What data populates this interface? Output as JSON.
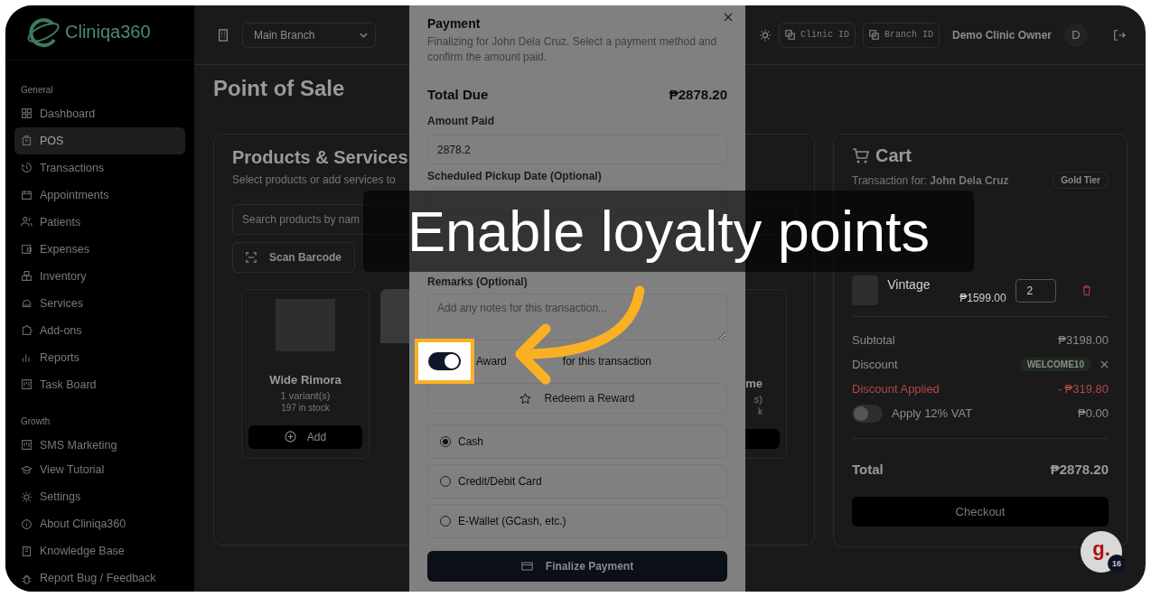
{
  "sidebar": {
    "logo": "Cliniqa360",
    "sections": [
      {
        "heading": "General",
        "items": [
          {
            "label": "Dashboard",
            "selected": false
          },
          {
            "label": "POS",
            "selected": true
          },
          {
            "label": "Transactions",
            "selected": false
          },
          {
            "label": "Appointments",
            "selected": false
          },
          {
            "label": "Patients",
            "selected": false
          },
          {
            "label": "Expenses",
            "selected": false
          },
          {
            "label": "Inventory",
            "selected": false
          },
          {
            "label": "Services",
            "selected": false
          },
          {
            "label": "Add-ons",
            "selected": false
          },
          {
            "label": "Reports",
            "selected": false
          },
          {
            "label": "Task Board",
            "selected": false
          }
        ]
      },
      {
        "heading": "Growth",
        "items": [
          {
            "label": "SMS Marketing",
            "selected": false
          }
        ]
      }
    ],
    "footer_items": [
      "View Tutorial",
      "Settings",
      "About Cliniqa360",
      "Knowledge Base",
      "Report Bug / Feedback"
    ]
  },
  "header": {
    "branch": "Main Branch",
    "clinic_id": "Clinic ID",
    "branch_id": "Branch ID",
    "user": "Demo Clinic Owner",
    "avatar": "D"
  },
  "page_title": "Point of Sale",
  "products": {
    "title": "Products & Services",
    "subtitle": "Select products or add services to",
    "search_placeholder": "Search products by nam",
    "scan_button": "Scan Barcode",
    "items": [
      {
        "kind": "full",
        "name": "Wide Rimora",
        "variants": "1 variant(s)",
        "stock": "197 in stock",
        "button": "Add"
      },
      {
        "kind": "photo"
      },
      {
        "kind": "hidden"
      },
      {
        "kind": "edge",
        "name": "me",
        "variants": "s)",
        "stock": "k"
      }
    ]
  },
  "cart": {
    "title": "Cart",
    "transaction_for": "Transaction for: **John Dela Cruz**",
    "tier": "Gold Tier",
    "item": {
      "name": "Vintage",
      "price": "₱1599.00",
      "quantity": "2"
    },
    "subtotal_label": "Subtotal",
    "subtotal": "₱3198.00",
    "discount_label": "Discount",
    "discount_code": "WELCOME10",
    "discount_applied_label": "Discount Applied",
    "discount_applied": "- ₱319.80",
    "vat": {
      "label": "Apply 12% VAT",
      "on": false,
      "amount": "₱0.00"
    },
    "total_label": "Total",
    "total": "₱2878.20",
    "checkout": "Checkout"
  },
  "payment_dialog": {
    "title": "Payment",
    "description": "Finalizing for John Dela Cruz. Select a payment method and confirm the amount paid.",
    "total_due_label": "Total Due",
    "total_due": "₱2878.20",
    "amount_label": "Amount Paid",
    "amount": "2878.2",
    "pickup_label": "Scheduled Pickup Date (Optional)",
    "remarks_label": "Remarks (Optional)",
    "remarks_placeholder": "Add any notes for this transaction...",
    "award": {
      "label_start": "Award",
      "label_end": "for this transaction",
      "on": true
    },
    "redeem_button": "Redeem a Reward",
    "methods": [
      {
        "label": "Cash",
        "selected": true
      },
      {
        "label": "Credit/Debit Card",
        "selected": false
      },
      {
        "label": "E-Wallet (GCash, etc.)",
        "selected": false
      }
    ],
    "finalize_button": "Finalize Payment"
  },
  "tutorial": {
    "caption": "Enable loyalty points"
  },
  "chat": {
    "logo": "g.",
    "badge": "16"
  }
}
